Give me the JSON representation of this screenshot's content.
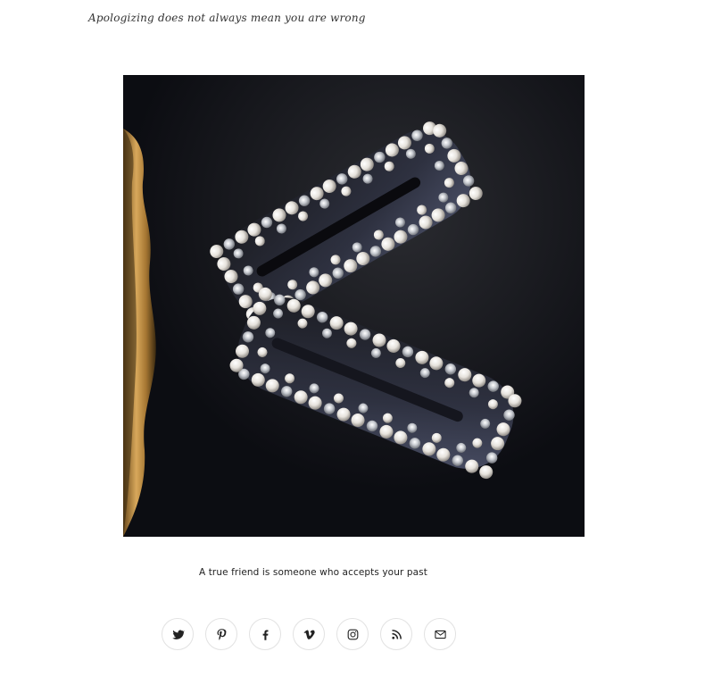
{
  "header": {
    "quote": "Apologizing does not always mean you are wrong"
  },
  "photo": {
    "alt": ""
  },
  "footer": {
    "quote": "A true friend is someone who accepts your past"
  },
  "social": [
    "twitter-icon",
    "pinterest-icon",
    "facebook-icon",
    "vimeo-icon",
    "instagram-icon",
    "rss-icon",
    "email-icon"
  ]
}
